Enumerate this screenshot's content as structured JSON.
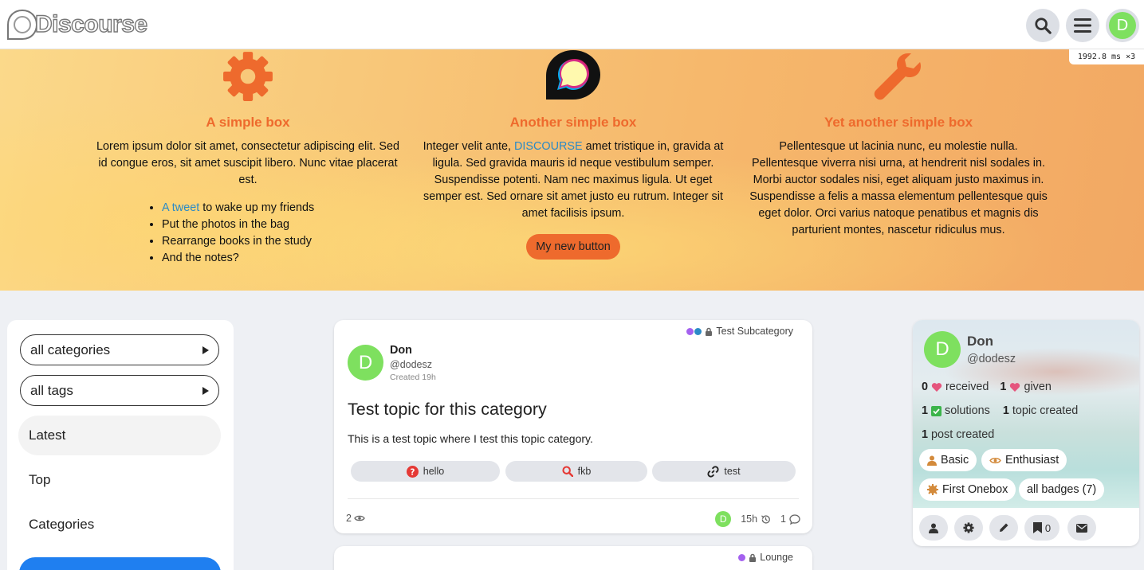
{
  "header": {
    "logo_text": "Discourse",
    "search_icon": "search-icon",
    "menu_icon": "hamburger-icon",
    "avatar_letter": "D",
    "timing": "1992.8 ms ×3"
  },
  "banner": {
    "boxes": [
      {
        "icon": "gear-icon",
        "title": "A simple box",
        "text": "Lorem ipsum dolor sit amet, consectetur adipiscing elit. Sed id congue eros, sit amet suscipit libero. Nunc vitae placerat est.",
        "list": [
          {
            "link": "A tweet",
            "rest": " to wake up my friends"
          },
          {
            "link": "",
            "rest": "Put the photos in the bag"
          },
          {
            "link": "",
            "rest": "Rearrange books in the study"
          },
          {
            "link": "",
            "rest": "And the notes?"
          }
        ]
      },
      {
        "icon": "discourse-logo-icon",
        "title": "Another simple box",
        "text_before": "Integer velit ante, ",
        "text_link": "DISCOURSE",
        "text_after": " amet tristique in, gravida at ligula. Sed gravida mauris id neque vestibulum semper. Suspendisse potenti. Nam nec maximus ligula. Ut eget semper est. Sed ornare sit amet justo eu rutrum. Integer sit amet facilisis ipsum.",
        "button": "My new button"
      },
      {
        "icon": "wrench-icon",
        "title": "Yet another simple box",
        "text": "Pellentesque ut lacinia nunc, eu molestie nulla. Pellentesque viverra nisi urna, at hendrerit nisl sodales in. Morbi auctor sodales nisi, eget aliquam justo maximus in. Suspendisse a felis a massa elementum pellentesque quis eget dolor. Orci varius natoque penatibus et magnis dis parturient montes, nascetur ridiculus mus."
      }
    ]
  },
  "sidebar": {
    "category_select": "all categories",
    "tag_select": "all tags",
    "nav": [
      "Latest",
      "Top",
      "Categories"
    ]
  },
  "topics": [
    {
      "category": "Test Subcategory",
      "author_name": "Don",
      "author_user": "@dodesz",
      "created": "Created 19h",
      "avatar_letter": "D",
      "title": "Test topic for this category",
      "excerpt": "This is a test topic where I test this topic category.",
      "tags": [
        "hello",
        "fkb",
        "test"
      ],
      "views": "2",
      "activity": "15h",
      "replies": "1"
    },
    {
      "category": "Lounge"
    }
  ],
  "user_card": {
    "name": "Don",
    "username": "@dodesz",
    "avatar_letter": "D",
    "likes_received": "0",
    "likes_received_label": "received",
    "likes_given": "1",
    "likes_given_label": "given",
    "solutions": "1",
    "solutions_label": "solutions",
    "topics_created": "1",
    "topics_created_label": "topic created",
    "posts_created": "1",
    "posts_created_label": "post created",
    "badges": [
      "Basic",
      "Enthusiast",
      "First Onebox",
      "all badges (7)"
    ],
    "bookmarks": "0"
  },
  "colors": {
    "accent": "#ee6a2d",
    "link": "#2b8ac7",
    "primary_button": "#1f7ff0",
    "avatar": "#7ee05f"
  }
}
